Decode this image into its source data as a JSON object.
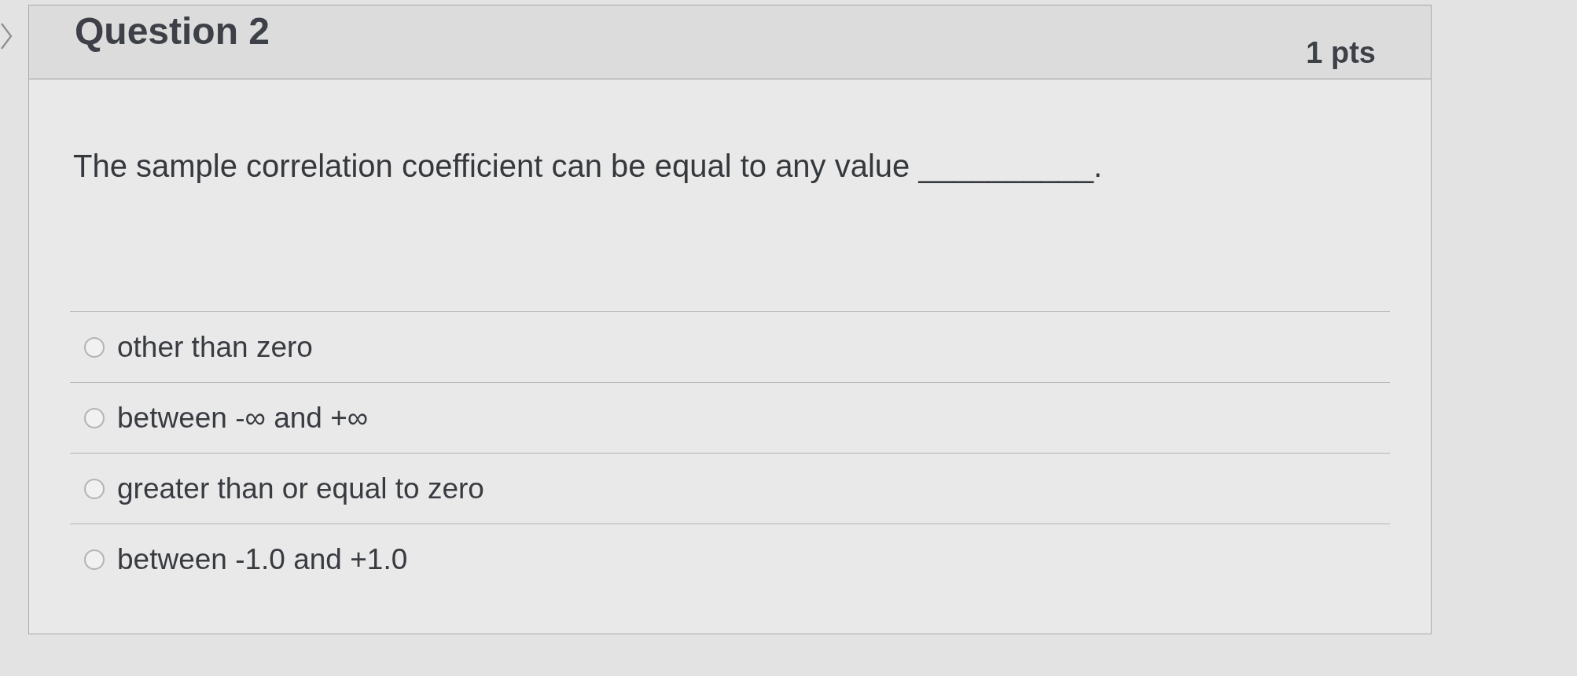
{
  "question": {
    "title": "Question 2",
    "points": "1 pts",
    "text": "The sample correlation coefficient can be equal to any value __________.",
    "answers": [
      {
        "label": "other than zero",
        "selected": false
      },
      {
        "label": "between -∞ and +∞",
        "selected": false
      },
      {
        "label": "greater than or equal to zero",
        "selected": false
      },
      {
        "label": "between -1.0 and +1.0",
        "selected": false
      }
    ]
  }
}
